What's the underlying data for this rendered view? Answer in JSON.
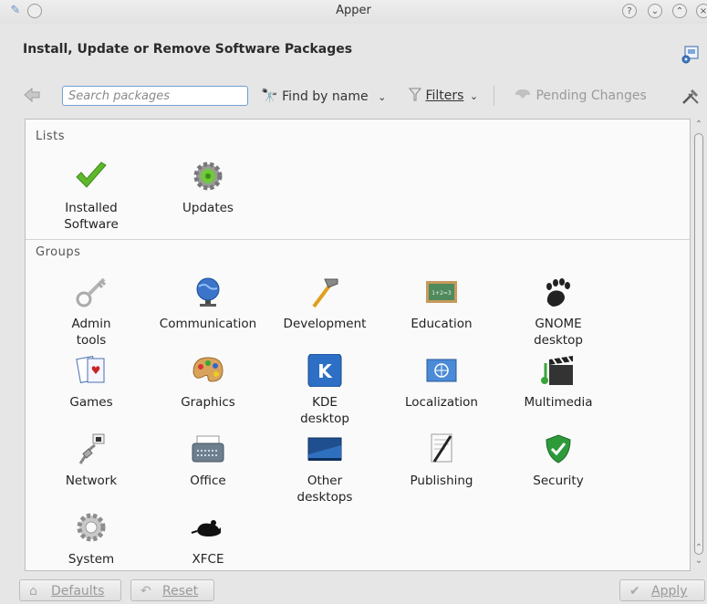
{
  "window": {
    "title": "Apper"
  },
  "header": {
    "title": "Install, Update or Remove Software Packages"
  },
  "toolbar": {
    "search_placeholder": "Search packages",
    "find_by_name": "Find by name",
    "filters": "Filters",
    "pending_changes": "Pending Changes"
  },
  "lists": {
    "title": "Lists",
    "items": [
      {
        "label": "Installed\nSoftware",
        "icon": "checkmark-icon"
      },
      {
        "label": "Updates",
        "icon": "updates-gear-icon"
      }
    ]
  },
  "groups": {
    "title": "Groups",
    "items": [
      {
        "label": "Admin\ntools",
        "icon": "key-icon"
      },
      {
        "label": "Communication",
        "icon": "globe-icon"
      },
      {
        "label": "Development",
        "icon": "hammer-icon"
      },
      {
        "label": "Education",
        "icon": "chalkboard-icon"
      },
      {
        "label": "GNOME\ndesktop",
        "icon": "gnome-foot-icon"
      },
      {
        "label": "Games",
        "icon": "cards-icon"
      },
      {
        "label": "Graphics",
        "icon": "palette-icon"
      },
      {
        "label": "KDE\ndesktop",
        "icon": "kde-icon"
      },
      {
        "label": "Localization",
        "icon": "un-flag-icon"
      },
      {
        "label": "Multimedia",
        "icon": "clapperboard-icon"
      },
      {
        "label": "Network",
        "icon": "network-plug-icon"
      },
      {
        "label": "Office",
        "icon": "typewriter-icon"
      },
      {
        "label": "Other\ndesktops",
        "icon": "desktop-icon"
      },
      {
        "label": "Publishing",
        "icon": "pen-paper-icon"
      },
      {
        "label": "Security",
        "icon": "shield-icon"
      },
      {
        "label": "System",
        "icon": "system-gear-icon"
      },
      {
        "label": "XFCE",
        "icon": "xfce-mouse-icon"
      }
    ]
  },
  "buttons": {
    "defaults": "Defaults",
    "reset": "Reset",
    "apply": "Apply"
  }
}
